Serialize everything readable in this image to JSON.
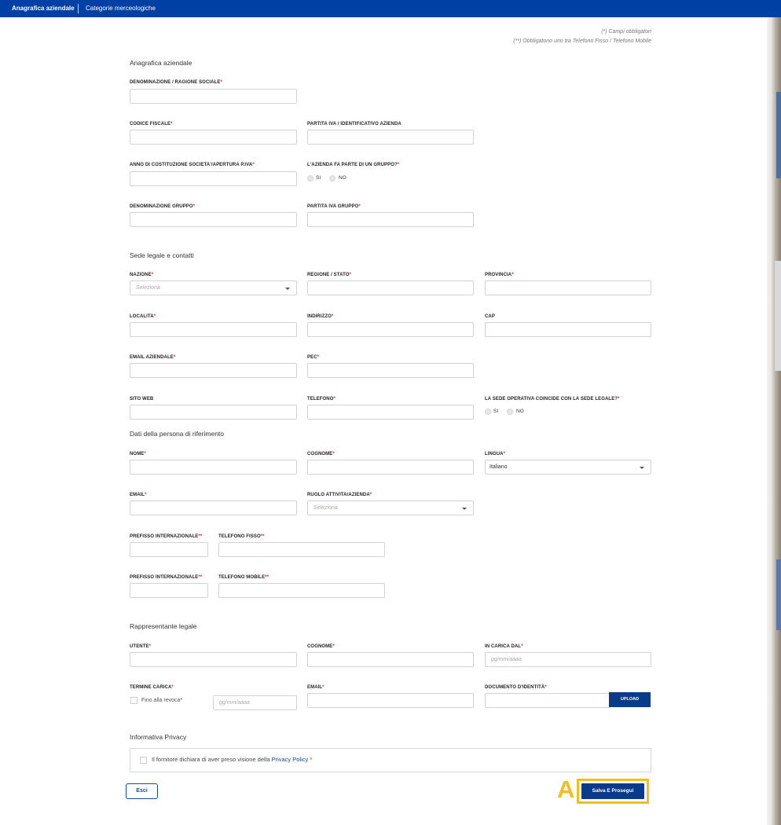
{
  "tabs": [
    {
      "label": "Anagrafica aziendale"
    },
    {
      "label": "Categorie merceologiche"
    }
  ],
  "notes": {
    "required": "(*) Campi obbligatori",
    "phone_required": "(**) Obbligatorio uno tra Telefono Fisso / Telefono Mobile"
  },
  "sections": {
    "company": "Anagrafica aziendale",
    "legal_seat": "Sede legale e contatti",
    "contact_person": "Dati della persona di riferimento",
    "legal_rep": "Rappresentante legale",
    "privacy": "Informativa Privacy"
  },
  "fields": {
    "denominazione": {
      "label": "DENOMINAZIONE / RAGIONE SOCIALE",
      "req": "*"
    },
    "codice_fiscale": {
      "label": "CODICE FISCALE",
      "req": "*"
    },
    "partita_iva": {
      "label": "PARTITA IVA / IDENTIFICATIVO AZIENDA",
      "req": ""
    },
    "anno_costituzione": {
      "label": "ANNO DI COSTITUZIONE SOCIETA'/APERTURA P.IVA",
      "req": "*"
    },
    "gruppo": {
      "label": "L'AZIENDA FA PARTE DI UN GRUPPO?",
      "req": "*",
      "yes": "SI",
      "no": "NO"
    },
    "denominazione_gruppo": {
      "label": "DENOMINAZIONE GRUPPO",
      "req": "*"
    },
    "partita_iva_gruppo": {
      "label": "PARTITA IVA GRUPPO",
      "req": "*"
    },
    "nazione": {
      "label": "NAZIONE",
      "req": "*",
      "placeholder": "Seleziona"
    },
    "regione": {
      "label": "REGIONE / STATO",
      "req": "*"
    },
    "provincia": {
      "label": "PROVINCIA",
      "req": "*"
    },
    "localita": {
      "label": "LOCALITA",
      "req": "*"
    },
    "indirizzo": {
      "label": "INDIRIZZO",
      "req": "*"
    },
    "cap": {
      "label": "CAP",
      "req": ""
    },
    "email_aziendale": {
      "label": "EMAIL AZIENDALE",
      "req": "*"
    },
    "pec": {
      "label": "PEC",
      "req": "*"
    },
    "sito_web": {
      "label": "SITO WEB",
      "req": ""
    },
    "telefono": {
      "label": "TELEFONO",
      "req": "*"
    },
    "sede_operativa": {
      "label": "LA SEDE OPERATIVA COINCIDE CON LA SEDE LEGALE?",
      "req": "*",
      "yes": "SI",
      "no": "NO"
    },
    "nome": {
      "label": "NOME",
      "req": "*"
    },
    "cognome": {
      "label": "COGNOME",
      "req": "*"
    },
    "lingua": {
      "label": "LINGUA",
      "req": "*",
      "value": "Italiano"
    },
    "email": {
      "label": "EMAIL",
      "req": "*"
    },
    "ruolo": {
      "label": "RUOLO ATTIVITA/AZIENDA",
      "req": "*",
      "placeholder": "Seleziona"
    },
    "prefisso_fisso": {
      "label": "PREFISSO INTERNAZIONALE",
      "req": "**"
    },
    "telefono_fisso": {
      "label": "TELEFONO FISSO",
      "req": "**"
    },
    "prefisso_mobile": {
      "label": "PREFISSO INTERNAZIONALE",
      "req": "**"
    },
    "telefono_mobile": {
      "label": "TELEFONO MOBILE",
      "req": "**"
    },
    "utente": {
      "label": "UTENTE",
      "req": "*"
    },
    "cognome_rep": {
      "label": "COGNOME",
      "req": "*"
    },
    "in_carica_dal": {
      "label": "IN CARICA DAL",
      "req": "*",
      "placeholder": "gg/mm/aaaa"
    },
    "termine_carica": {
      "label": "TERMINE CARICA",
      "req": "*",
      "checkbox": "Fino alla revoca",
      "checkbox_req": "*",
      "placeholder": "gg/mm/aaaa"
    },
    "email_rep": {
      "label": "EMAIL",
      "req": "*"
    },
    "documento": {
      "label": "DOCUMENTO D'IDENTITÀ",
      "req": "*",
      "button": "UPLOAD"
    }
  },
  "privacy": {
    "text_before": "Il fornitore dichiara di aver preso visione della ",
    "link": "Privacy Policy",
    "req": "*"
  },
  "buttons": {
    "esci": "Esci",
    "save": "Salva E Prosegui"
  },
  "annotation": {
    "marker": "A",
    "color": "#f2c01c"
  },
  "colors": {
    "brand": "#003fa3",
    "required": "#d1202f",
    "button": "#0a3a8c"
  }
}
